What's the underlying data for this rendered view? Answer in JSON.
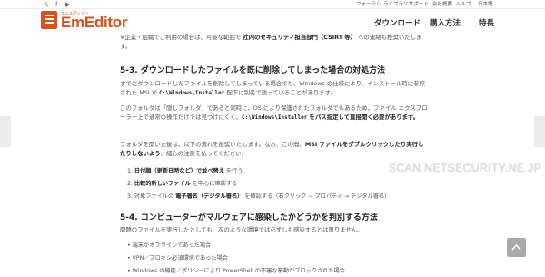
{
  "social": {
    "x": "𝕏",
    "facebook": "f",
    "youtube": "▶"
  },
  "utility_nav": [
    "フォーラム",
    "ライブラリ",
    "サポート",
    "会社概要",
    "ヘルプ",
    "日本語"
  ],
  "logo": {
    "small": "エムエディター",
    "text": "EmEditor"
  },
  "nav": [
    "ダウンロード",
    "購入方法",
    "特長"
  ],
  "article": {
    "intro": {
      "pre": "※企業・組織でご利用の場合は、可能な範囲で ",
      "strong": "社内のセキュリティ担当部門（CSIRT 等）",
      "post": " への連絡も推奨いたします。"
    },
    "h53": "5-3. ダウンロードしたファイルを既に削除してしまった場合の対処方法",
    "p1": {
      "a": "すでにダウンロードしたファイルを削除してしまっている場合でも、Windows の仕様により、インストール時に参照された MSI が ",
      "code": "C:\\Windows\\Installer",
      "b": " 配下に別名で残っていることがあります。"
    },
    "p2": {
      "a": "このフォルダは「隠しフォルダ」であると同時に、OS により保護されたフォルダでもあるため、ファイル エクスプローラー上で通常の操作だけでは見つけにくく、",
      "code": "C:\\Windows\\Installer",
      "b": " をパス指定して直接開く必要があります。"
    },
    "p3": {
      "a": "フォルダを開いた後は、以下の流れを推奨いたします。なお、この間、",
      "strong": "MSI ファイルをダブルクリックしたり実行したりしないよう",
      "b": "、細心の注意を払ってください。"
    },
    "list": [
      {
        "num": "1.",
        "strong": "日付順（更新日時など）で並べ替え",
        "rest": " を行う"
      },
      {
        "num": "2.",
        "strong": "比較的新しいファイル",
        "rest": " を中心に確認する"
      },
      {
        "num": "3.",
        "pre": "対象ファイルの ",
        "strong": "電子署名（デジタル署名）",
        "rest": " を確認する（右クリック → プロパティ → デジタル署名）"
      }
    ],
    "h54": "5-4. コンピューターがマルウェアに感染したかどうかを判別する方法",
    "p4": "問題のファイルを実行したとしても、次のような環境では必ずしも感染するとは限りません。",
    "bullets": [
      "端末がオフラインであった場合",
      "VPN／プロキシ必須環境であった場合",
      "Windows の機能／ポリシーにより PowerShell の不審な挙動がブロックされた場合"
    ]
  },
  "watermark": "SCAN.NETSECURITY.NE.JP",
  "colors": {
    "accent": "#d9521f",
    "text": "#555555",
    "heading": "#222222"
  }
}
